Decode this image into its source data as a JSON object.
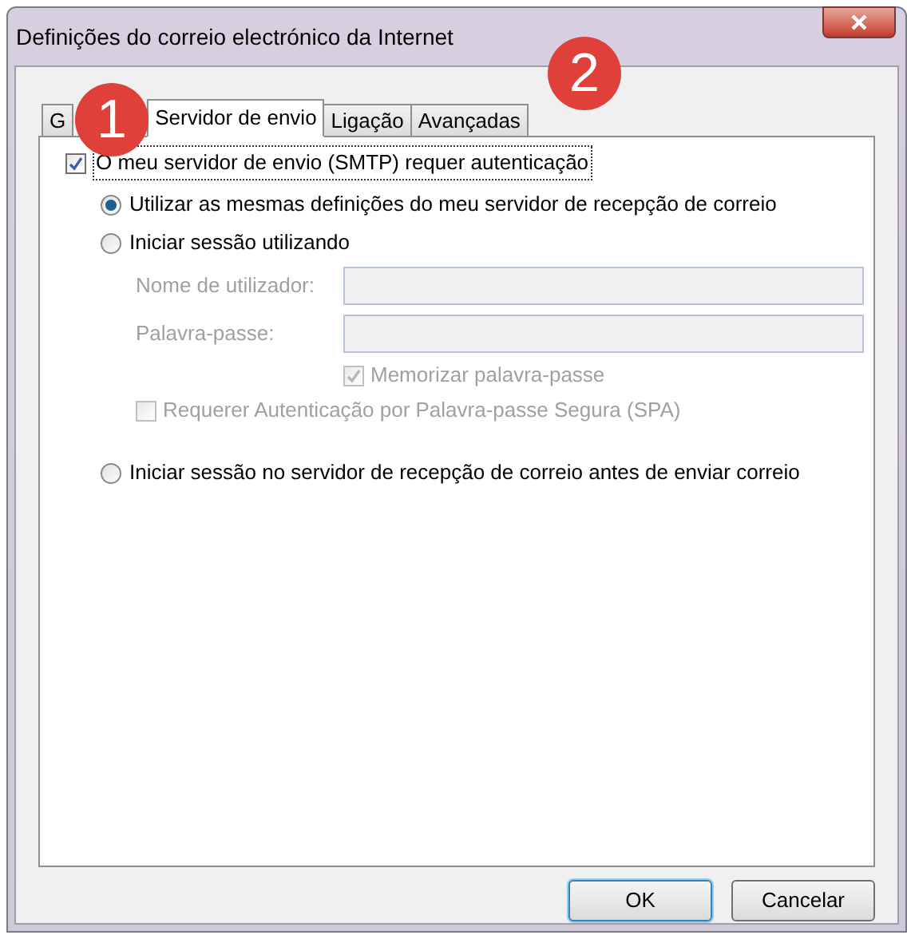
{
  "window": {
    "title": "Definições do correio electrónico da Internet"
  },
  "tabs": [
    {
      "label": "G",
      "selected": false
    },
    {
      "label": "Servidor de envio",
      "selected": true
    },
    {
      "label": "Ligação",
      "selected": false
    },
    {
      "label": "Avançadas",
      "selected": false
    }
  ],
  "smtp_auth": {
    "label": "O meu servidor de envio (SMTP) requer autenticação",
    "checked": true
  },
  "options": [
    {
      "kind": "radio",
      "label": "Utilizar as mesmas definições do meu servidor de recepção de correio",
      "selected": true,
      "disabled": false
    },
    {
      "kind": "radio",
      "label": "Iniciar sessão utilizando",
      "selected": false,
      "disabled": false
    },
    {
      "kind": "field",
      "label": "Nome de utilizador:",
      "disabled": true
    },
    {
      "kind": "field",
      "label": "Palavra-passe:",
      "disabled": true
    },
    {
      "kind": "field-check",
      "label": "Memorizar palavra-passe",
      "checked": true,
      "disabled": true
    },
    {
      "kind": "check",
      "label": "Requerer Autenticação por Palavra-passe Segura (SPA)",
      "checked": false,
      "disabled": true
    },
    {
      "kind": "radio",
      "label": "Iniciar sessão no servidor de recepção de correio antes de enviar correio",
      "selected": false,
      "disabled": false,
      "gap": true
    }
  ],
  "buttons": [
    {
      "label": "OK",
      "default": true
    },
    {
      "label": "Cancelar",
      "default": false
    }
  ],
  "annotations": [
    {
      "label": "1"
    },
    {
      "label": "2"
    }
  ]
}
